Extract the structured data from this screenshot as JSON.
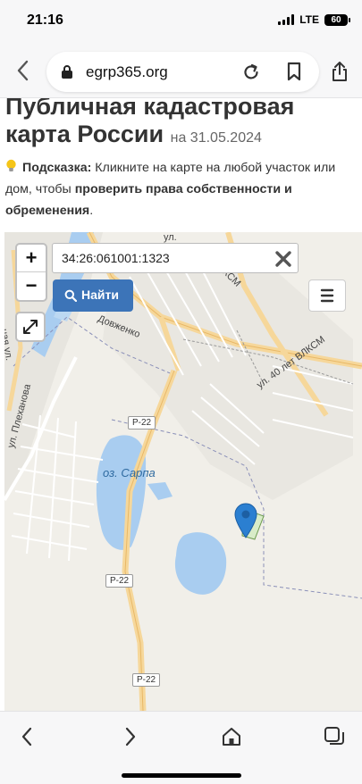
{
  "status": {
    "time": "21:16",
    "network": "LTE",
    "battery": "60"
  },
  "browser": {
    "url": "egrp365.org"
  },
  "page": {
    "title": "Публичная кадастровая карта России",
    "title_date": "на 31.05.2024",
    "hint_label": "Подсказка:",
    "hint_text": " Кликните на карте на любой участок или дом, чтобы ",
    "hint_bold": "проверить права собственности и обременения",
    "hint_end": "."
  },
  "map": {
    "zoom_in": "+",
    "zoom_out": "−",
    "search_value": "34:26:061001:1323",
    "find_label": "Найти",
    "labels": {
      "ul_top": "ул.",
      "vlksm": "ВЛКСМ",
      "dovzhenko": "Довженко",
      "ul_40_let": "ул. 40 лет ВЛКСМ",
      "plekhanova": "ул. Плеханова",
      "naya_ul": "ная ул.",
      "lake": "оз. Сарпа",
      "r22_a": "Р-22",
      "r22_b": "Р-22",
      "r22_c": "Р-22"
    }
  }
}
